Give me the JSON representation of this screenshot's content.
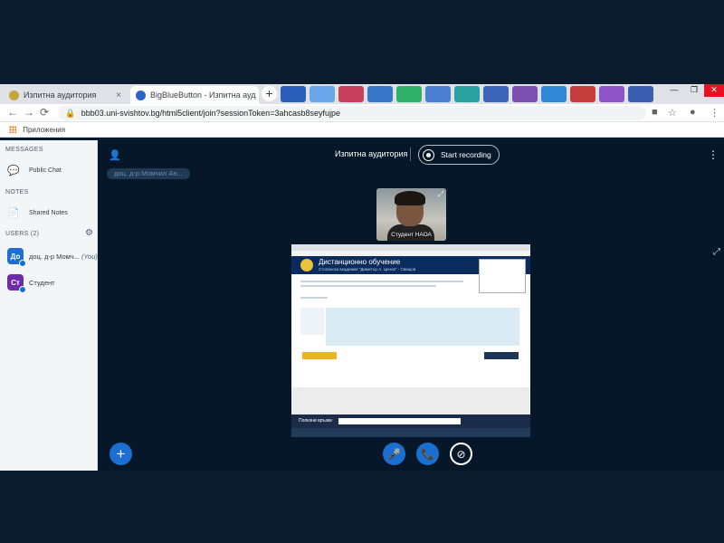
{
  "browser": {
    "tabs": [
      {
        "label": "Изпитна аудитория",
        "close": "×"
      },
      {
        "label": "BigBlueButton - Изпитна ауд",
        "close": "×"
      }
    ],
    "new_tab": "+",
    "window_controls": [
      "—",
      "❐",
      "✕"
    ],
    "url": "bbb03.uni-svishtov.bg/html5client/join?sessionToken=3ahcasb8seyfujpe",
    "bookmarks_label": "Приложения"
  },
  "sidebar": {
    "messages_title": "MESSAGES",
    "public_chat": "Public Chat",
    "notes_title": "NOTES",
    "shared_notes": "Shared Notes",
    "users_title": "USERS (2)",
    "users": [
      {
        "initials": "До",
        "name": "доц. д-р Момч...",
        "you": "(You)",
        "color": "#1f6fd0"
      },
      {
        "initials": "Ст",
        "name": "Студент",
        "color": "#6d2ba8"
      }
    ]
  },
  "main": {
    "meeting_title": "Изпитна аудитория",
    "record_label": "Start recording",
    "talking_indicator": "доц. д-р Момчил Ан...",
    "webcam_name": "Студент НАОА",
    "share_header_title": "Дистанционно обучение",
    "share_header_subtitle": "Стопанска академия \"Димитър А. Ценов\" - Свищов",
    "share_footer": "Полезни връзки"
  },
  "icons": {
    "user": "👤",
    "kebab": "⋮",
    "chat": "💬",
    "notes": "📄",
    "gear": "⚙",
    "plus": "+",
    "mic": "🎤",
    "phone": "📞",
    "camera_off": "⊘",
    "fullscreen": "⤢",
    "back": "←",
    "forward": "→",
    "reload": "⟳",
    "lock": "🔒",
    "star": "☆",
    "account": "●",
    "menu": "⋮"
  },
  "colors": {
    "primary": "#1b6fd1",
    "main_bg": "#06172a",
    "sidebar_bg": "#f3f6f9"
  }
}
